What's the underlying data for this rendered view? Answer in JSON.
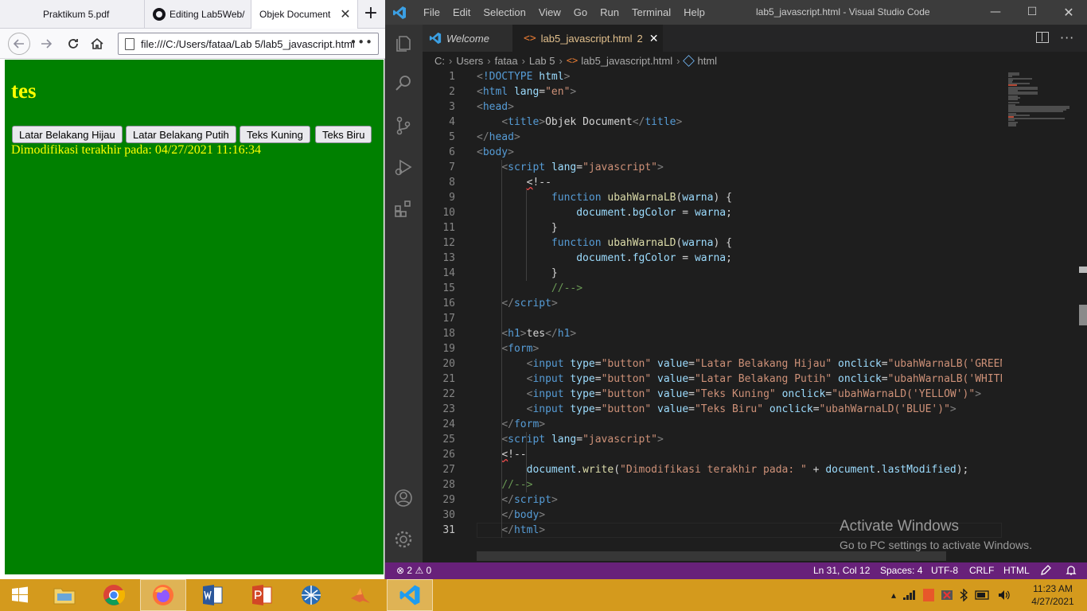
{
  "browser": {
    "tabs": [
      {
        "label": "Praktikum 5.pdf"
      },
      {
        "label": "Editing Lab5Web/"
      },
      {
        "label": "Objek Document",
        "close": "✕"
      }
    ],
    "new_tab": "+",
    "url": "file:///C:/Users/fataa/Lab 5/lab5_javascript.html",
    "url_more": "•••",
    "page": {
      "heading": "tes",
      "buttons": [
        "Latar Belakang Hijau",
        "Latar Belakang Putih",
        "Teks Kuning",
        "Teks Biru"
      ],
      "modified": "Dimodifikasi terakhir pada: 04/27/2021 11:16:34",
      "background": "#008000",
      "text_color": "#ffff00"
    }
  },
  "vscode": {
    "menu": [
      "File",
      "Edit",
      "Selection",
      "View",
      "Go",
      "Run",
      "Terminal",
      "Help"
    ],
    "window_title": "lab5_javascript.html - Visual Studio Code",
    "window_controls": {
      "minimize": "—",
      "maximize": "☐",
      "close": "✕"
    },
    "tabs": {
      "welcome": "Welcome",
      "file": "lab5_javascript.html",
      "file_badge": "2",
      "file_icon": "<>",
      "close": "✕"
    },
    "more": "···",
    "breadcrumbs": [
      "C:",
      "Users",
      "fataa",
      "Lab 5",
      "lab5_javascript.html",
      "html"
    ],
    "breadcrumb_sep": "›",
    "breadcrumb_code_icon": "<>",
    "line_numbers": [
      "1",
      "2",
      "3",
      "4",
      "5",
      "6",
      "7",
      "8",
      "9",
      "10",
      "11",
      "12",
      "13",
      "14",
      "15",
      "16",
      "17",
      "18",
      "19",
      "20",
      "21",
      "22",
      "23",
      "24",
      "25",
      "26",
      "27",
      "28",
      "29",
      "30",
      "31"
    ],
    "current_line": "31",
    "watermark": {
      "title": "Activate Windows",
      "subtitle": "Go to PC settings to activate Windows."
    },
    "status": {
      "errors": "2",
      "warnings": "0",
      "position": "Ln 31, Col 12",
      "spaces": "Spaces: 4",
      "encoding": "UTF-8",
      "eol": "CRLF",
      "language": "HTML"
    },
    "theme": {
      "statusbar": "#68217a",
      "background": "#1e1e1e"
    }
  },
  "code": [
    [
      [
        "c-ang",
        "<"
      ],
      [
        "c-tag",
        "!DOCTYPE"
      ],
      [
        "c-txt",
        " "
      ],
      [
        "c-attr",
        "html"
      ],
      [
        "c-ang",
        ">"
      ]
    ],
    [
      [
        "c-ang",
        "<"
      ],
      [
        "c-tag",
        "html"
      ],
      [
        "c-txt",
        " "
      ],
      [
        "c-attr",
        "lang"
      ],
      [
        "c-txt",
        "="
      ],
      [
        "c-str",
        "\"en\""
      ],
      [
        "c-ang",
        ">"
      ]
    ],
    [
      [
        "c-ang",
        "<"
      ],
      [
        "c-tag",
        "head"
      ],
      [
        "c-ang",
        ">"
      ]
    ],
    [
      [
        "c-txt",
        "    "
      ],
      [
        "c-ang",
        "<"
      ],
      [
        "c-tag",
        "title"
      ],
      [
        "c-ang",
        ">"
      ],
      [
        "c-txt",
        "Objek Document"
      ],
      [
        "c-ang",
        "</"
      ],
      [
        "c-tag",
        "title"
      ],
      [
        "c-ang",
        ">"
      ]
    ],
    [
      [
        "c-ang",
        "</"
      ],
      [
        "c-tag",
        "head"
      ],
      [
        "c-ang",
        ">"
      ]
    ],
    [
      [
        "c-ang",
        "<"
      ],
      [
        "c-tag",
        "body"
      ],
      [
        "c-ang",
        ">"
      ]
    ],
    [
      [
        "c-txt",
        "    "
      ],
      [
        "c-ang",
        "<"
      ],
      [
        "c-tag",
        "script"
      ],
      [
        "c-txt",
        " "
      ],
      [
        "c-attr",
        "lang"
      ],
      [
        "c-txt",
        "="
      ],
      [
        "c-str",
        "\"javascript\""
      ],
      [
        "c-ang",
        ">"
      ]
    ],
    [
      [
        "c-txt",
        "        "
      ],
      [
        "c-err",
        "<"
      ],
      [
        "c-txt",
        "!--"
      ]
    ],
    [
      [
        "c-txt",
        "            "
      ],
      [
        "c-kw",
        "function"
      ],
      [
        "c-txt",
        " "
      ],
      [
        "c-fn",
        "ubahWarnaLB"
      ],
      [
        "c-txt",
        "("
      ],
      [
        "c-var",
        "warna"
      ],
      [
        "c-txt",
        ") {"
      ]
    ],
    [
      [
        "c-txt",
        "                "
      ],
      [
        "c-var",
        "document"
      ],
      [
        "c-txt",
        "."
      ],
      [
        "c-var",
        "bgColor"
      ],
      [
        "c-txt",
        " = "
      ],
      [
        "c-var",
        "warna"
      ],
      [
        "c-txt",
        ";"
      ]
    ],
    [
      [
        "c-txt",
        "            }"
      ]
    ],
    [
      [
        "c-txt",
        "            "
      ],
      [
        "c-kw",
        "function"
      ],
      [
        "c-txt",
        " "
      ],
      [
        "c-fn",
        "ubahWarnaLD"
      ],
      [
        "c-txt",
        "("
      ],
      [
        "c-var",
        "warna"
      ],
      [
        "c-txt",
        ") {"
      ]
    ],
    [
      [
        "c-txt",
        "                "
      ],
      [
        "c-var",
        "document"
      ],
      [
        "c-txt",
        "."
      ],
      [
        "c-var",
        "fgColor"
      ],
      [
        "c-txt",
        " = "
      ],
      [
        "c-var",
        "warna"
      ],
      [
        "c-txt",
        ";"
      ]
    ],
    [
      [
        "c-txt",
        "            }"
      ]
    ],
    [
      [
        "c-txt",
        "            "
      ],
      [
        "c-cmt",
        "//-->"
      ]
    ],
    [
      [
        "c-txt",
        "    "
      ],
      [
        "c-ang",
        "</"
      ],
      [
        "c-tag",
        "script"
      ],
      [
        "c-ang",
        ">"
      ]
    ],
    [
      [
        "c-txt",
        ""
      ]
    ],
    [
      [
        "c-txt",
        "    "
      ],
      [
        "c-ang",
        "<"
      ],
      [
        "c-tag",
        "h1"
      ],
      [
        "c-ang",
        ">"
      ],
      [
        "c-txt",
        "tes"
      ],
      [
        "c-ang",
        "</"
      ],
      [
        "c-tag",
        "h1"
      ],
      [
        "c-ang",
        ">"
      ]
    ],
    [
      [
        "c-txt",
        "    "
      ],
      [
        "c-ang",
        "<"
      ],
      [
        "c-tag",
        "form"
      ],
      [
        "c-ang",
        ">"
      ]
    ],
    [
      [
        "c-txt",
        "        "
      ],
      [
        "c-ang",
        "<"
      ],
      [
        "c-tag",
        "input"
      ],
      [
        "c-txt",
        " "
      ],
      [
        "c-attr",
        "type"
      ],
      [
        "c-txt",
        "="
      ],
      [
        "c-str",
        "\"button\""
      ],
      [
        "c-txt",
        " "
      ],
      [
        "c-attr",
        "value"
      ],
      [
        "c-txt",
        "="
      ],
      [
        "c-str",
        "\"Latar Belakang Hijau\""
      ],
      [
        "c-txt",
        " "
      ],
      [
        "c-attr",
        "onclick"
      ],
      [
        "c-txt",
        "="
      ],
      [
        "c-str",
        "\"ubahWarnaLB('GREEN'"
      ]
    ],
    [
      [
        "c-txt",
        "        "
      ],
      [
        "c-ang",
        "<"
      ],
      [
        "c-tag",
        "input"
      ],
      [
        "c-txt",
        " "
      ],
      [
        "c-attr",
        "type"
      ],
      [
        "c-txt",
        "="
      ],
      [
        "c-str",
        "\"button\""
      ],
      [
        "c-txt",
        " "
      ],
      [
        "c-attr",
        "value"
      ],
      [
        "c-txt",
        "="
      ],
      [
        "c-str",
        "\"Latar Belakang Putih\""
      ],
      [
        "c-txt",
        " "
      ],
      [
        "c-attr",
        "onclick"
      ],
      [
        "c-txt",
        "="
      ],
      [
        "c-str",
        "\"ubahWarnaLB('WHITE'"
      ]
    ],
    [
      [
        "c-txt",
        "        "
      ],
      [
        "c-ang",
        "<"
      ],
      [
        "c-tag",
        "input"
      ],
      [
        "c-txt",
        " "
      ],
      [
        "c-attr",
        "type"
      ],
      [
        "c-txt",
        "="
      ],
      [
        "c-str",
        "\"button\""
      ],
      [
        "c-txt",
        " "
      ],
      [
        "c-attr",
        "value"
      ],
      [
        "c-txt",
        "="
      ],
      [
        "c-str",
        "\"Teks Kuning\""
      ],
      [
        "c-txt",
        " "
      ],
      [
        "c-attr",
        "onclick"
      ],
      [
        "c-txt",
        "="
      ],
      [
        "c-str",
        "\"ubahWarnaLD('YELLOW')\""
      ],
      [
        "c-ang",
        ">"
      ]
    ],
    [
      [
        "c-txt",
        "        "
      ],
      [
        "c-ang",
        "<"
      ],
      [
        "c-tag",
        "input"
      ],
      [
        "c-txt",
        " "
      ],
      [
        "c-attr",
        "type"
      ],
      [
        "c-txt",
        "="
      ],
      [
        "c-str",
        "\"button\""
      ],
      [
        "c-txt",
        " "
      ],
      [
        "c-attr",
        "value"
      ],
      [
        "c-txt",
        "="
      ],
      [
        "c-str",
        "\"Teks Biru\""
      ],
      [
        "c-txt",
        " "
      ],
      [
        "c-attr",
        "onclick"
      ],
      [
        "c-txt",
        "="
      ],
      [
        "c-str",
        "\"ubahWarnaLD('BLUE')\""
      ],
      [
        "c-ang",
        ">"
      ]
    ],
    [
      [
        "c-txt",
        "    "
      ],
      [
        "c-ang",
        "</"
      ],
      [
        "c-tag",
        "form"
      ],
      [
        "c-ang",
        ">"
      ]
    ],
    [
      [
        "c-txt",
        "    "
      ],
      [
        "c-ang",
        "<"
      ],
      [
        "c-tag",
        "script"
      ],
      [
        "c-txt",
        " "
      ],
      [
        "c-attr",
        "lang"
      ],
      [
        "c-txt",
        "="
      ],
      [
        "c-str",
        "\"javascript\""
      ],
      [
        "c-ang",
        ">"
      ]
    ],
    [
      [
        "c-txt",
        "    "
      ],
      [
        "c-err",
        "<"
      ],
      [
        "c-txt",
        "!--"
      ]
    ],
    [
      [
        "c-txt",
        "        "
      ],
      [
        "c-var",
        "document"
      ],
      [
        "c-txt",
        "."
      ],
      [
        "c-fn",
        "write"
      ],
      [
        "c-txt",
        "("
      ],
      [
        "c-str",
        "\"Dimodifikasi terakhir pada: \""
      ],
      [
        "c-txt",
        " + "
      ],
      [
        "c-var",
        "document"
      ],
      [
        "c-txt",
        "."
      ],
      [
        "c-var",
        "lastModified"
      ],
      [
        "c-txt",
        ");"
      ]
    ],
    [
      [
        "c-txt",
        "    "
      ],
      [
        "c-cmt",
        "//-->"
      ]
    ],
    [
      [
        "c-txt",
        "    "
      ],
      [
        "c-ang",
        "</"
      ],
      [
        "c-tag",
        "script"
      ],
      [
        "c-ang",
        ">"
      ]
    ],
    [
      [
        "c-txt",
        "    "
      ],
      [
        "c-ang",
        "</"
      ],
      [
        "c-tag",
        "body"
      ],
      [
        "c-ang",
        ">"
      ]
    ],
    [
      [
        "c-txt",
        "    "
      ],
      [
        "c-ang",
        "</"
      ],
      [
        "c-tag",
        "html"
      ],
      [
        "c-ang",
        ">"
      ]
    ]
  ],
  "taskbar": {
    "clock_time": "11:23 AM",
    "clock_date": "4/27/2021",
    "accent": "#d49a1d"
  }
}
